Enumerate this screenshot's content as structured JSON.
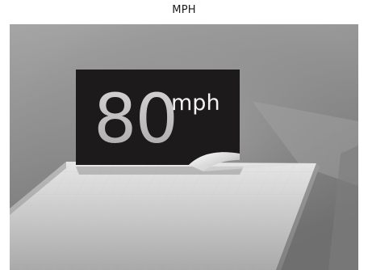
{
  "caption": "MPH",
  "sign": {
    "value": "80",
    "unit": "mph"
  },
  "colors": {
    "background": "#ffffff",
    "scene_base": "#8a8a8a",
    "sign_face": "#1c1a1b",
    "sign_text": "#c4c4c4",
    "unit_text": "#f2f2f2"
  }
}
